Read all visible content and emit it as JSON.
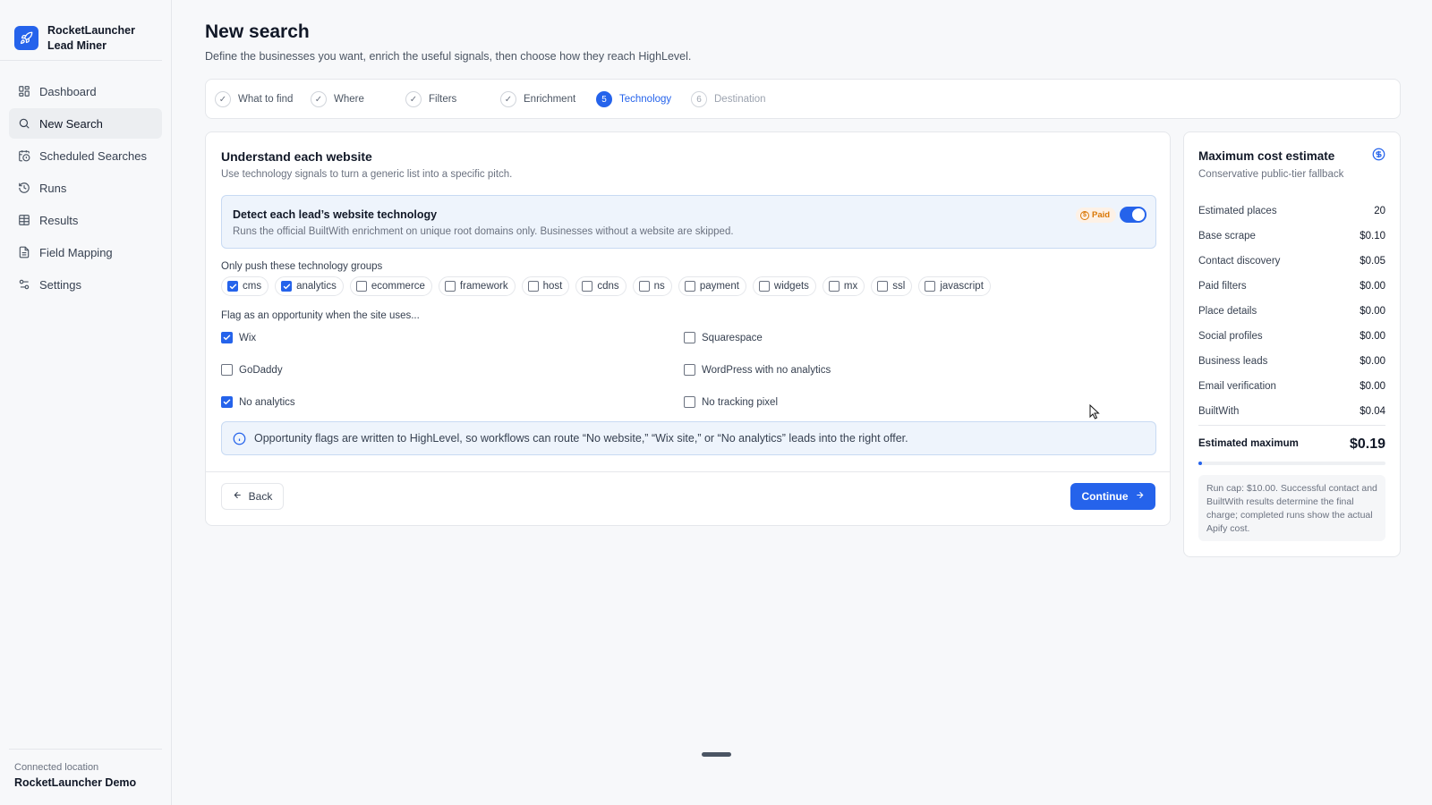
{
  "brand": {
    "name_line1": "RocketLauncher",
    "name_line2": "Lead Miner"
  },
  "nav": [
    {
      "label": "Dashboard",
      "icon": "dashboard-icon"
    },
    {
      "label": "New Search",
      "icon": "search-icon",
      "active": true
    },
    {
      "label": "Scheduled Searches",
      "icon": "calendar-clock-icon"
    },
    {
      "label": "Runs",
      "icon": "history-icon"
    },
    {
      "label": "Results",
      "icon": "table-icon"
    },
    {
      "label": "Field Mapping",
      "icon": "file-icon"
    },
    {
      "label": "Settings",
      "icon": "sliders-icon"
    }
  ],
  "footer": {
    "caption": "Connected location",
    "location": "RocketLauncher Demo"
  },
  "page": {
    "title": "New search",
    "subtitle": "Define the businesses you want, enrich the useful signals, then choose how they reach HighLevel."
  },
  "steps": [
    {
      "label": "What to find",
      "state": "done",
      "marker": "✓"
    },
    {
      "label": "Where",
      "state": "done",
      "marker": "✓"
    },
    {
      "label": "Filters",
      "state": "done",
      "marker": "✓"
    },
    {
      "label": "Enrichment",
      "state": "done",
      "marker": "✓"
    },
    {
      "label": "Technology",
      "state": "current",
      "marker": "5"
    },
    {
      "label": "Destination",
      "state": "pending",
      "marker": "6"
    }
  ],
  "card": {
    "title": "Understand each website",
    "subtitle": "Use technology signals to turn a generic list into a specific pitch.",
    "tech": {
      "title": "Detect each lead’s website technology",
      "description": "Runs the official BuiltWith enrichment on unique root domains only. Businesses without a website are skipped.",
      "badge": "Paid",
      "enabled": true
    },
    "groups_label": "Only push these technology groups",
    "groups": [
      {
        "label": "cms",
        "checked": true
      },
      {
        "label": "analytics",
        "checked": true
      },
      {
        "label": "ecommerce",
        "checked": false
      },
      {
        "label": "framework",
        "checked": false
      },
      {
        "label": "host",
        "checked": false
      },
      {
        "label": "cdns",
        "checked": false
      },
      {
        "label": "ns",
        "checked": false
      },
      {
        "label": "payment",
        "checked": false
      },
      {
        "label": "widgets",
        "checked": false
      },
      {
        "label": "mx",
        "checked": false
      },
      {
        "label": "ssl",
        "checked": false
      },
      {
        "label": "javascript",
        "checked": false
      }
    ],
    "flags_label": "Flag as an opportunity when the site uses...",
    "flags": [
      {
        "label": "Wix",
        "checked": true
      },
      {
        "label": "Squarespace",
        "checked": false
      },
      {
        "label": "GoDaddy",
        "checked": false
      },
      {
        "label": "WordPress with no analytics",
        "checked": false
      },
      {
        "label": "No analytics",
        "checked": true
      },
      {
        "label": "No tracking pixel",
        "checked": false
      }
    ],
    "info": "Opportunity flags are written to HighLevel, so workflows can route “No website,” “Wix site,” or “No analytics” leads into the right offer.",
    "back_label": "Back",
    "continue_label": "Continue"
  },
  "cost": {
    "title": "Maximum cost estimate",
    "subtitle": "Conservative public-tier fallback",
    "rows": [
      {
        "label": "Estimated places",
        "value": "20"
      },
      {
        "label": "Base scrape",
        "value": "$0.10"
      },
      {
        "label": "Contact discovery",
        "value": "$0.05"
      },
      {
        "label": "Paid filters",
        "value": "$0.00"
      },
      {
        "label": "Place details",
        "value": "$0.00"
      },
      {
        "label": "Social profiles",
        "value": "$0.00"
      },
      {
        "label": "Business leads",
        "value": "$0.00"
      },
      {
        "label": "Email verification",
        "value": "$0.00"
      },
      {
        "label": "BuiltWith",
        "value": "$0.04"
      }
    ],
    "estimated_label": "Estimated maximum",
    "estimated_value": "$0.19",
    "usage_fraction": 0.019,
    "cap_note": "Run cap: $10.00. Successful contact and BuiltWith results determine the final charge; completed runs show the actual Apify cost."
  },
  "colors": {
    "accent": "#2563eb",
    "paid": "#d97706"
  }
}
